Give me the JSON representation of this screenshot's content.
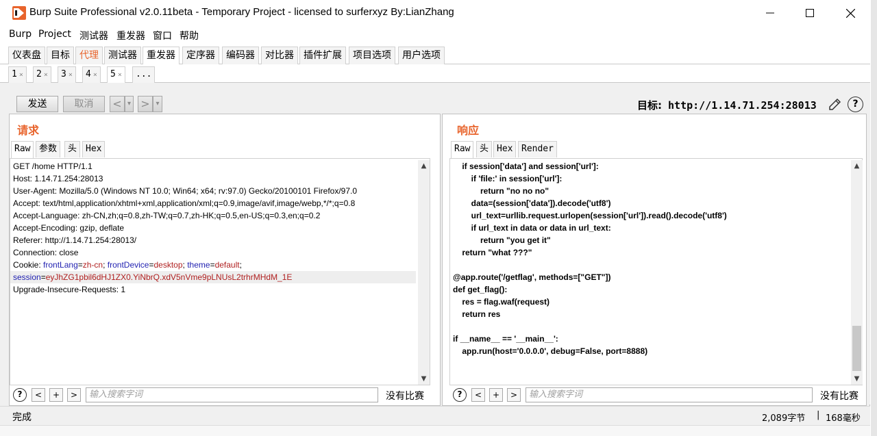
{
  "window": {
    "title": "Burp Suite Professional v2.0.11beta - Temporary Project - licensed to surferxyz By:LianZhang"
  },
  "menu": [
    "Burp",
    "Project",
    "测试器",
    "重发器",
    "窗口",
    "帮助"
  ],
  "main_tabs": [
    {
      "label": "仪表盘"
    },
    {
      "label": "目标"
    },
    {
      "label": "代理"
    },
    {
      "label": "测试器"
    },
    {
      "label": "重发器"
    },
    {
      "label": "定序器"
    },
    {
      "label": "编码器"
    },
    {
      "label": "对比器"
    },
    {
      "label": "插件扩展"
    },
    {
      "label": "项目选项"
    },
    {
      "label": "用户选项"
    }
  ],
  "repeater_tabs": [
    {
      "label": "1",
      "close": "×"
    },
    {
      "label": "2",
      "close": "×"
    },
    {
      "label": "3",
      "close": "×"
    },
    {
      "label": "4",
      "close": "×"
    },
    {
      "label": "5",
      "close": "×"
    },
    {
      "label": "..."
    }
  ],
  "toolbar": {
    "send": "发送",
    "cancel": "取消",
    "prev": "<",
    "next": ">",
    "dropdown": "▾",
    "target_label": "目标:",
    "target_url": "http://1.14.71.254:28013"
  },
  "request": {
    "title": "请求",
    "tabs": [
      "Raw",
      "参数",
      "头",
      "Hex"
    ],
    "lines": [
      "GET /home HTTP/1.1",
      "Host: 1.14.71.254:28013",
      "User-Agent: Mozilla/5.0 (Windows NT 10.0; Win64; x64; rv:97.0) Gecko/20100101 Firefox/97.0",
      "Accept: text/html,application/xhtml+xml,application/xml;q=0.9,image/avif,image/webp,*/*;q=0.8",
      "Accept-Language: zh-CN,zh;q=0.8,zh-TW;q=0.7,zh-HK;q=0.5,en-US;q=0.3,en;q=0.2",
      "Accept-Encoding: gzip, deflate",
      "Referer: http://1.14.71.254:28013/",
      "Connection: close"
    ],
    "cookie": {
      "prefix": "Cookie: ",
      "k1": "frontLang",
      "v1": "zh-cn",
      "k2": "frontDevice",
      "v2": "desktop",
      "k3": "theme",
      "v3": "default",
      "session_key": "session",
      "session_value": "eyJhZG1pbil6dHJ1ZX0.YiNbrQ.xdV5nVme9pLNUsL2trhrMHdM_1E"
    },
    "last_line": "Upgrade-Insecure-Requests: 1",
    "search_placeholder": "输入搜索字词",
    "no_match": "没有比赛"
  },
  "response": {
    "title": "响应",
    "tabs": [
      "Raw",
      "头",
      "Hex",
      "Render"
    ],
    "lines": [
      "    if session['data'] and session['url']:",
      "        if 'file:' in session['url']:",
      "            return \"no no no\"",
      "        data=(session['data']).decode('utf8')",
      "        url_text=urllib.request.urlopen(session['url']).read().decode('utf8')",
      "        if url_text in data or data in url_text:",
      "            return \"you get it\"",
      "    return \"what ???\"",
      "",
      "@app.route('/getflag', methods=[\"GET\"])",
      "def get_flag():",
      "    res = flag.waf(request)",
      "    return res",
      "",
      "if __name__ == '__main__':",
      "    app.run(host='0.0.0.0', debug=False, port=8888)"
    ],
    "search_placeholder": "输入搜索字词",
    "no_match": "没有比赛"
  },
  "status": {
    "left": "完成",
    "bytes": "2,089字节",
    "separator": "|",
    "time": "168毫秒"
  },
  "colors": {
    "accent": "#e8642c",
    "cookie_key": "#1f1fb0",
    "cookie_value": "#b02020"
  }
}
